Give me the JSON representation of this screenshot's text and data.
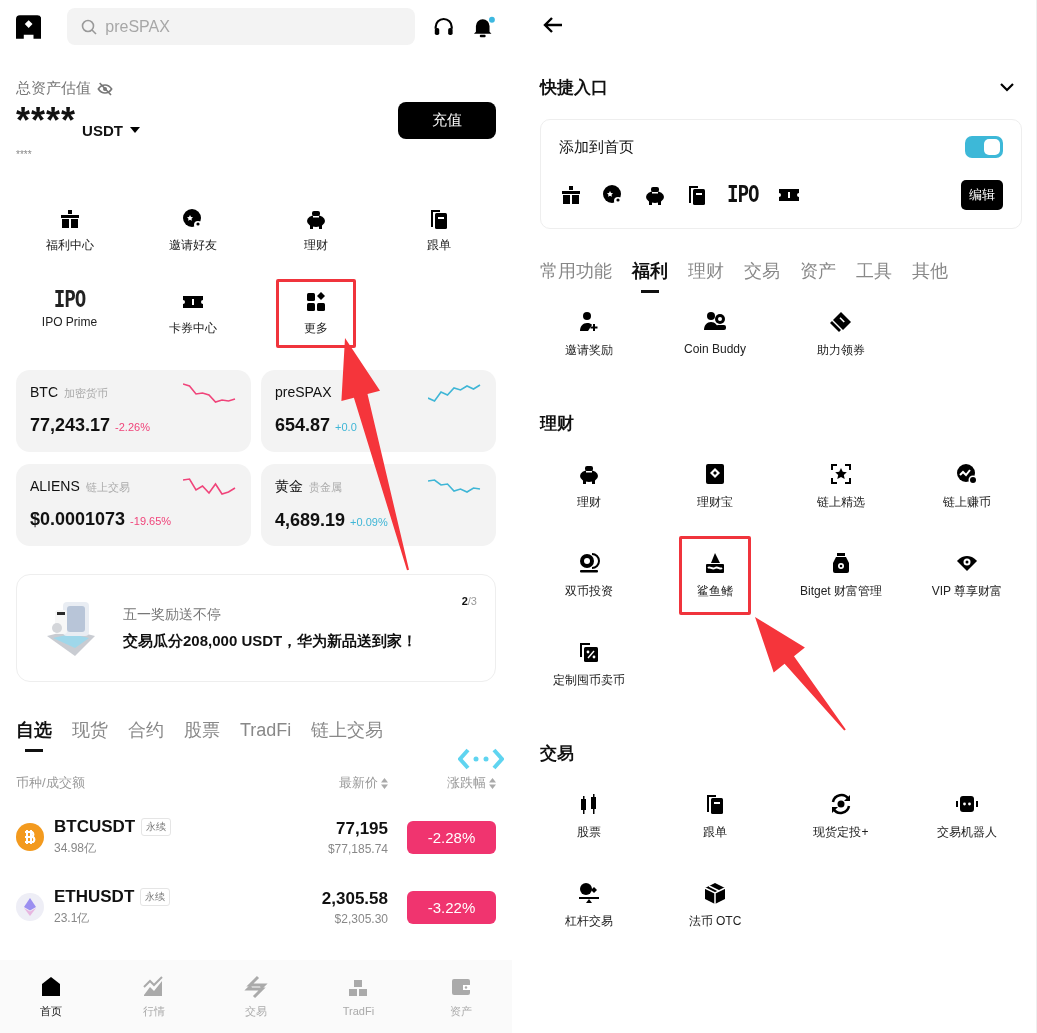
{
  "home": {
    "search": {
      "placeholder": "preSPAX"
    },
    "balance": {
      "label": "总资产估值",
      "amount": "****",
      "currency": "USDT",
      "sub": "****",
      "deposit_button": "充值"
    },
    "shortcuts": [
      {
        "kind": "gift",
        "label": "福利中心",
        "highlighted": false
      },
      {
        "kind": "invite",
        "label": "邀请好友",
        "highlighted": false
      },
      {
        "kind": "piggy",
        "label": "理财",
        "highlighted": false
      },
      {
        "kind": "copy",
        "label": "跟单",
        "highlighted": false
      },
      {
        "kind": "ipo",
        "icon_text": "IPO",
        "label": "IPO Prime",
        "highlighted": false
      },
      {
        "kind": "ticket",
        "label": "卡券中心",
        "highlighted": false
      },
      {
        "kind": "more",
        "label": "更多",
        "highlighted": true
      }
    ],
    "markets": [
      {
        "symbol": "BTC",
        "tag": "加密货币",
        "price": "77,243.17",
        "change": "-2.26%",
        "color": "#f0447a"
      },
      {
        "symbol": "preSPAX",
        "price": "654.87",
        "change": "+0.0",
        "color": "#3fb6d6"
      },
      {
        "symbol": "ALIENS",
        "tag": "链上交易",
        "price": "$0.0001073",
        "change": "-19.65%",
        "color": "#f0447a"
      },
      {
        "symbol": "黄金",
        "tag": "贵金属",
        "price": "4,689.19",
        "change": "+0.09%",
        "color": "#3fb6d6"
      }
    ],
    "banner": {
      "title": "五一奖励送不停",
      "text": "交易瓜分208,000 USDT，华为新品送到家！",
      "page": "2",
      "total": "/3"
    },
    "list_tabs": [
      {
        "label": "自选",
        "selected": true
      },
      {
        "label": "现货",
        "selected": false
      },
      {
        "label": "合约",
        "selected": false
      },
      {
        "label": "股票",
        "selected": false
      },
      {
        "label": "TradFi",
        "selected": false
      },
      {
        "label": "链上交易",
        "selected": false
      }
    ],
    "columns": [
      "币种/成交额",
      "最新价",
      "涨跌幅"
    ],
    "rows": [
      {
        "kind": "btc",
        "pair": "BTCUSDT",
        "badge": "永续",
        "volume": "34.98亿",
        "price": "77,195",
        "price_usd": "$77,185.74",
        "change": "-2.28%"
      },
      {
        "kind": "eth",
        "pair": "ETHUSDT",
        "badge": "永续",
        "volume": "23.1亿",
        "price": "2,305.58",
        "price_usd": "$2,305.30",
        "change": "-3.22%"
      }
    ],
    "nav": [
      {
        "kind": "home",
        "label": "首页",
        "selected": true
      },
      {
        "kind": "chart",
        "label": "行情",
        "selected": false
      },
      {
        "kind": "swap",
        "label": "交易",
        "selected": false
      },
      {
        "kind": "bars",
        "label": "TradFi",
        "selected": false
      },
      {
        "kind": "wallet",
        "label": "资产",
        "selected": false
      }
    ]
  },
  "settings": {
    "title": "快捷入口",
    "card": {
      "label": "添加到首页",
      "on": true,
      "edit_button": "编辑",
      "pinned": [
        {
          "kind": "gift"
        },
        {
          "kind": "invite"
        },
        {
          "kind": "piggy"
        },
        {
          "kind": "copy"
        },
        {
          "kind": "ipo",
          "icon_text": "IPO"
        },
        {
          "kind": "ticket"
        }
      ]
    },
    "tabs": [
      {
        "label": "常用功能",
        "selected": false
      },
      {
        "label": "福利",
        "selected": true
      },
      {
        "label": "理财",
        "selected": false
      },
      {
        "label": "交易",
        "selected": false
      },
      {
        "label": "资产",
        "selected": false
      },
      {
        "label": "工具",
        "selected": false
      },
      {
        "label": "其他",
        "selected": false
      }
    ],
    "groups": [
      {
        "items": [
          {
            "kind": "personadd",
            "label": "邀请奖励",
            "highlighted": false
          },
          {
            "kind": "buddy",
            "label": "Coin Buddy",
            "highlighted": false
          },
          {
            "kind": "coupon",
            "label": "助力领券",
            "highlighted": false
          }
        ]
      },
      {
        "title": "理财",
        "items": [
          {
            "kind": "piggy",
            "label": "理财",
            "highlighted": false
          },
          {
            "kind": "vault",
            "label": "理财宝",
            "highlighted": false
          },
          {
            "kind": "scanstar",
            "label": "链上精选",
            "highlighted": false
          },
          {
            "kind": "earn",
            "label": "链上赚币",
            "highlighted": false
          },
          {
            "kind": "dual",
            "label": "双币投资",
            "highlighted": false
          },
          {
            "kind": "shark",
            "label": "鲨鱼鳍",
            "highlighted": true
          },
          {
            "kind": "bag",
            "label": "Bitget 财富管理",
            "highlighted": false
          },
          {
            "kind": "vip",
            "label": "VIP 尊享财富",
            "highlighted": false
          },
          {
            "kind": "percent",
            "label": "定制囤币卖币",
            "highlighted": false
          }
        ]
      },
      {
        "title": "交易",
        "items": [
          {
            "kind": "candles",
            "label": "股票",
            "highlighted": false
          },
          {
            "kind": "copy",
            "label": "跟单",
            "highlighted": false
          },
          {
            "kind": "cycle",
            "label": "现货定投+",
            "highlighted": false
          },
          {
            "kind": "robot",
            "label": "交易机器人",
            "highlighted": false
          },
          {
            "kind": "leverage",
            "label": "杠杆交易",
            "highlighted": false
          },
          {
            "kind": "box",
            "label": "法币 OTC",
            "highlighted": false
          }
        ]
      }
    ]
  }
}
